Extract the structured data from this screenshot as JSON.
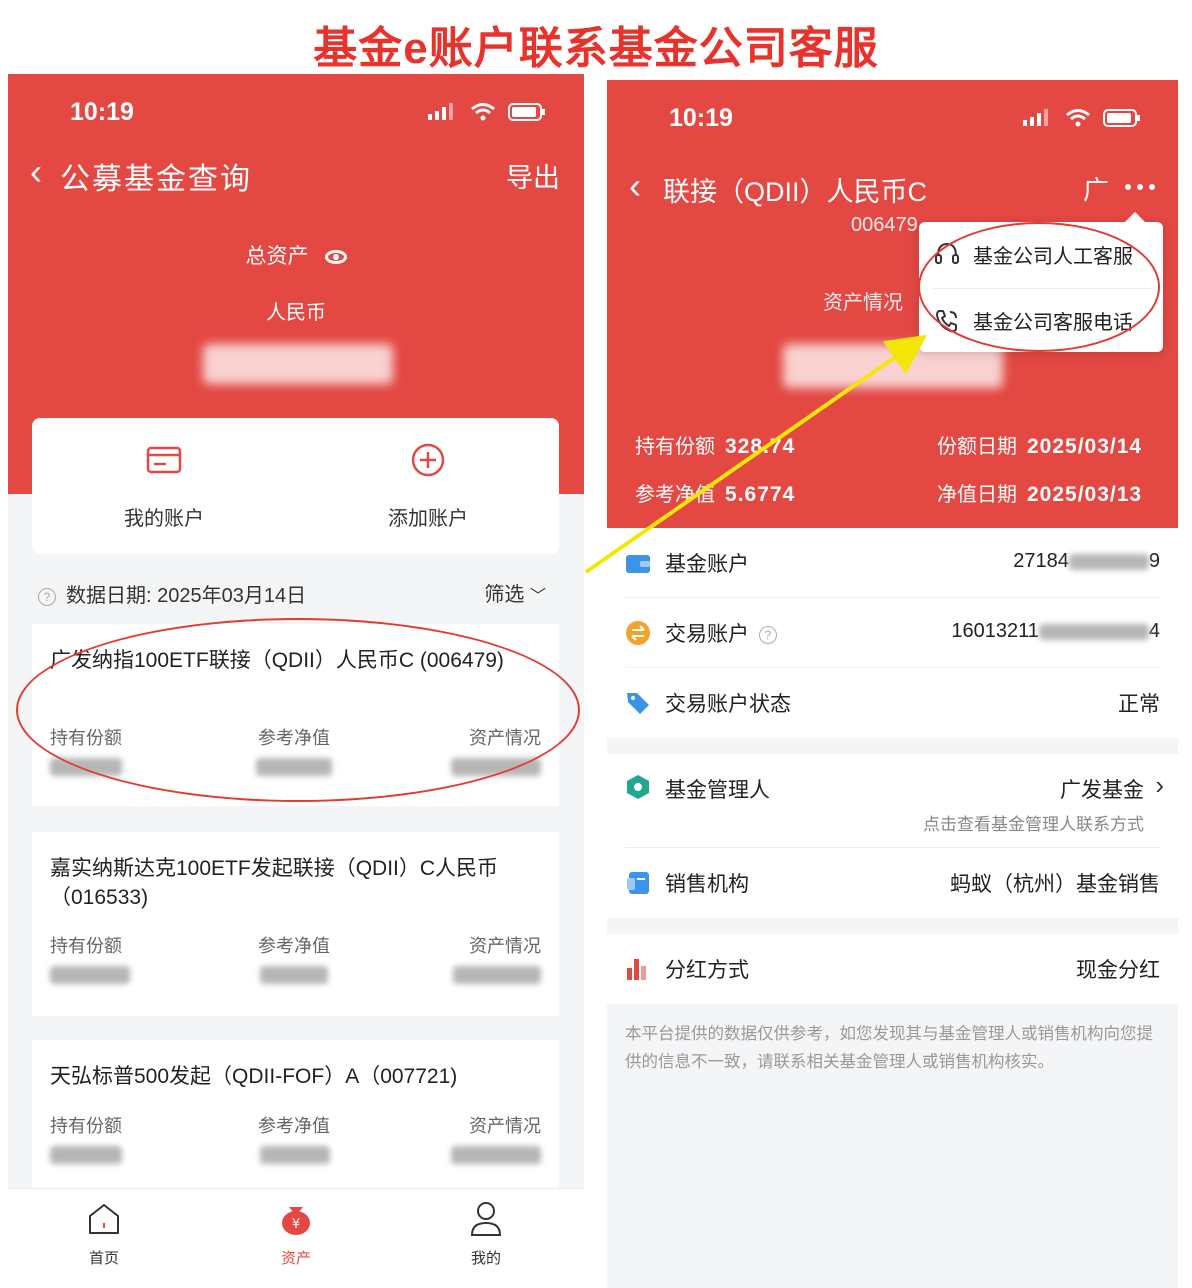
{
  "page_title": "基金e账户联系基金公司客服",
  "left": {
    "status_time": "10:19",
    "nav": {
      "title": "公募基金查询",
      "export": "导出"
    },
    "total_assets_label": "总资产",
    "currency": "人民币",
    "actions": {
      "my_account": "我的账户",
      "add_account": "添加账户"
    },
    "data_date": "数据日期: 2025年03月14日",
    "filter_label": "筛选",
    "col_labels": {
      "shares": "持有份额",
      "nav": "参考净值",
      "assets": "资产情况"
    },
    "funds": [
      {
        "name": "广发纳指100ETF联接（QDII）人民币C (006479)"
      },
      {
        "name": "嘉实纳斯达克100ETF发起联接（QDII）C人民币（016533)"
      },
      {
        "name": "天弘标普500发起（QDII-FOF）A（007721)"
      }
    ],
    "tabs": {
      "home": "首页",
      "assets": "资产",
      "mine": "我的"
    }
  },
  "right": {
    "status_time": "10:19",
    "nav": {
      "title": "联接（QDII）人民币C",
      "code": "006479",
      "extra": "广"
    },
    "asset_label": "资产情况",
    "popup": {
      "item1": "基金公司人工客服",
      "item2": "基金公司客服电话"
    },
    "stats": {
      "shares_label": "持有份额",
      "shares_value": "328.74",
      "share_date_label": "份额日期",
      "share_date_value": "2025/03/14",
      "nav_label": "参考净值",
      "nav_value": "5.6774",
      "nav_date_label": "净值日期",
      "nav_date_value": "2025/03/13"
    },
    "rows": {
      "fund_account": {
        "label": "基金账户",
        "value_prefix": "27184",
        "value_suffix": "9"
      },
      "trade_account": {
        "label": "交易账户",
        "value_prefix": "16013211",
        "value_suffix": "4"
      },
      "trade_status": {
        "label": "交易账户状态",
        "value": "正常"
      },
      "manager": {
        "label": "基金管理人",
        "value": "广发基金",
        "sub": "点击查看基金管理人联系方式"
      },
      "seller": {
        "label": "销售机构",
        "value": "蚂蚁（杭州）基金销售"
      },
      "dividend": {
        "label": "分红方式",
        "value": "现金分红"
      }
    },
    "disclaimer": "本平台提供的数据仅供参考，如您发现其与基金管理人或销售机构向您提供的信息不一致，请联系相关基金管理人或销售机构核实。"
  },
  "colors": {
    "brand_red": "#e34843",
    "annotation_red": "#e53a32",
    "arrow_yellow": "#f5e60a"
  }
}
